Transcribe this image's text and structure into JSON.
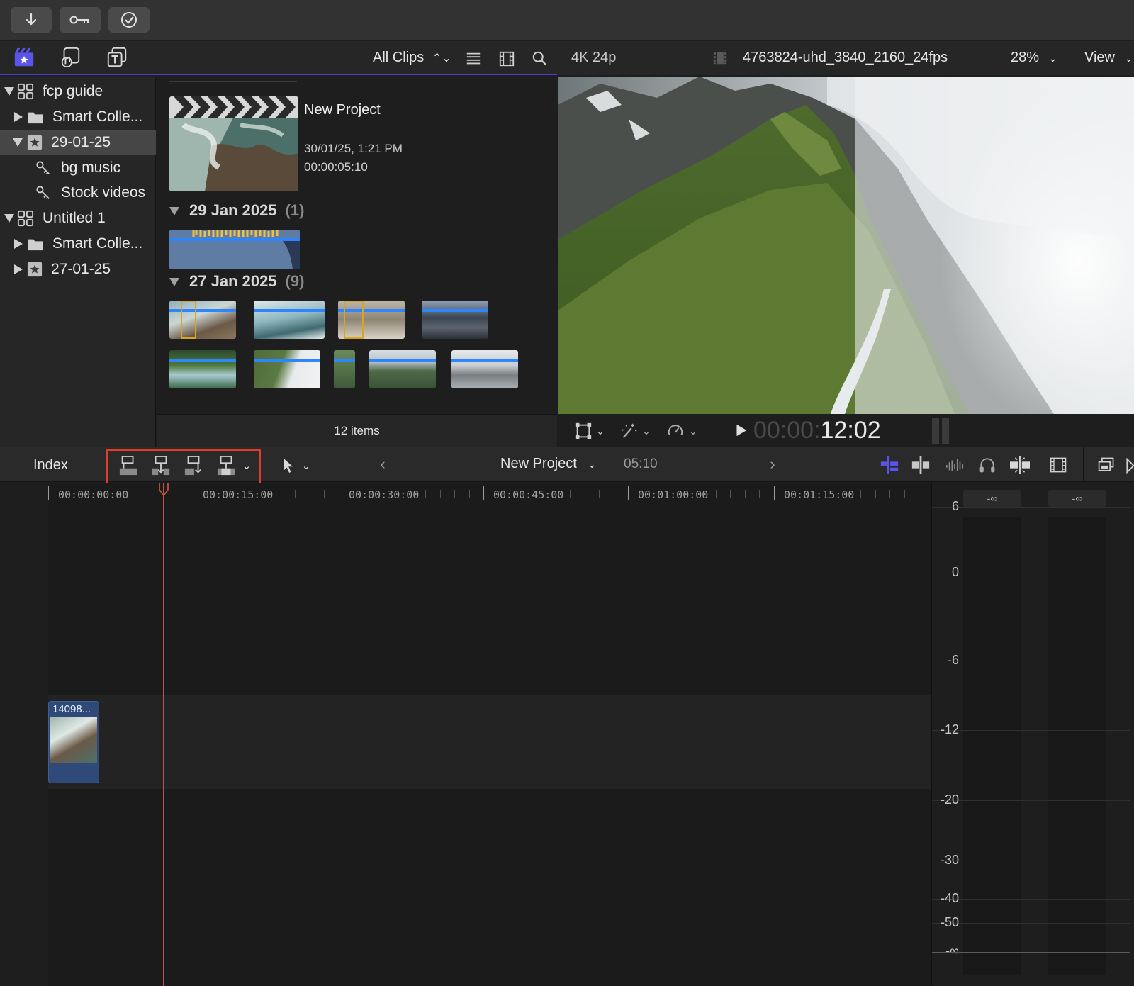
{
  "toolbar": {
    "import_icon": "down-arrow-icon",
    "keyword_icon": "key-icon",
    "background_tasks_icon": "checkmark-circle-icon"
  },
  "browser_bar": {
    "filter_label": "All Clips",
    "icons": [
      "libraries-icon",
      "photos-audio-icon",
      "titles-generators-icon",
      "list-view-icon",
      "filmstrip-icon",
      "search-icon"
    ]
  },
  "viewer_bar": {
    "format": "4K 24p",
    "clip_name": "4763824-uhd_3840_2160_24fps",
    "zoom": "28%",
    "view_label": "View"
  },
  "sidebar": {
    "items": [
      {
        "label": "fcp guide",
        "type": "library",
        "expanded": true,
        "level": 0
      },
      {
        "label": "Smart Colle...",
        "type": "folder",
        "expanded": false,
        "level": 1
      },
      {
        "label": "29-01-25",
        "type": "event",
        "expanded": true,
        "level": 1,
        "selected": true
      },
      {
        "label": "bg music",
        "type": "keyword",
        "level": 2
      },
      {
        "label": "Stock videos",
        "type": "keyword",
        "level": 2
      },
      {
        "label": "Untitled 1",
        "type": "library",
        "expanded": true,
        "level": 0
      },
      {
        "label": "Smart Colle...",
        "type": "folder",
        "expanded": false,
        "level": 1
      },
      {
        "label": "27-01-25",
        "type": "event",
        "expanded": false,
        "level": 1
      }
    ]
  },
  "browser": {
    "project": {
      "name": "New Project",
      "date": "30/01/25, 1:21 PM",
      "duration": "00:00:05:10"
    },
    "groups": [
      {
        "title": "29 Jan 2025",
        "count": "(1)"
      },
      {
        "title": "27 Jan 2025",
        "count": "(9)"
      }
    ],
    "footer": "12 items"
  },
  "viewer_controls": {
    "timecode_dim": "00:00:",
    "timecode_bright": "12:02"
  },
  "timeline_bar": {
    "index_label": "Index",
    "project_name": "New Project",
    "duration": "05:10"
  },
  "ruler": {
    "labels": [
      "00:00:00:00",
      "00:00:15:00",
      "00:00:30:00",
      "00:00:45:00",
      "00:01:00:00",
      "00:01:15:00"
    ]
  },
  "timeline": {
    "clip_label": "14098..."
  },
  "meters": {
    "scale": [
      "6",
      "0",
      "-6",
      "-12",
      "-20",
      "-30",
      "-40",
      "-50",
      "-∞"
    ],
    "peak_left": "-∞",
    "peak_right": "-∞"
  },
  "colors": {
    "accent": "#4a3fd0",
    "playhead": "#c0523e",
    "highlight": "#e23b2e",
    "clip_bar": "#2e86ff"
  }
}
